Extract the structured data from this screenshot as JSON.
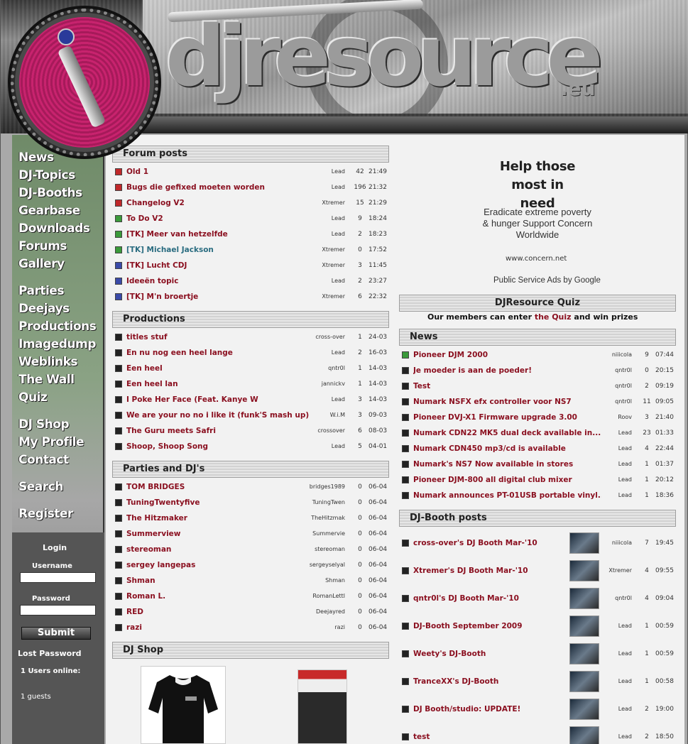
{
  "site": {
    "logo_text": "djresource",
    "logo_tld": ".eu"
  },
  "nav": [
    "News",
    "DJ-Topics",
    "DJ-Booths",
    "Gearbase",
    "Downloads",
    "Forums",
    "Gallery",
    "Parties",
    "Deejays",
    "Productions",
    "Imagedump",
    "Weblinks",
    "The Wall",
    "Quiz",
    "DJ Shop",
    "My Profile",
    "Contact",
    "Search",
    "Register"
  ],
  "login": {
    "title": "Login",
    "username_label": "Username",
    "password_label": "Password",
    "submit": "Submit",
    "lost_password": "Lost Password",
    "users_online": "1 Users online:",
    "guests": "1 guests"
  },
  "forum": {
    "title": "Forum posts",
    "rows": [
      {
        "color": "red",
        "title": "Old 1",
        "user": "Lead",
        "count": "42",
        "time": "21:49"
      },
      {
        "color": "red",
        "title": "Bugs die gefixed moeten worden",
        "user": "Lead",
        "count": "196",
        "time": "21:32"
      },
      {
        "color": "red",
        "title": "Changelog V2",
        "user": "Xtremer",
        "count": "15",
        "time": "21:29"
      },
      {
        "color": "green",
        "title": "To Do V2",
        "user": "Lead",
        "count": "9",
        "time": "18:24"
      },
      {
        "color": "green",
        "title": "[TK] Meer van hetzelfde",
        "user": "Lead",
        "count": "2",
        "time": "18:23"
      },
      {
        "color": "green",
        "title": "[TK] Michael Jackson",
        "user": "Xtremer",
        "count": "0",
        "time": "17:52",
        "teal": true
      },
      {
        "color": "blue",
        "title": "[TK] Lucht CDJ",
        "user": "Xtremer",
        "count": "3",
        "time": "11:45"
      },
      {
        "color": "blue",
        "title": "Ideeën topic",
        "user": "Lead",
        "count": "2",
        "time": "23:27"
      },
      {
        "color": "blue",
        "title": "[TK] M'n broertje",
        "user": "Xtremer",
        "count": "6",
        "time": "22:32"
      }
    ]
  },
  "productions": {
    "title": "Productions",
    "rows": [
      {
        "title": "titles stuf",
        "user": "cross-over",
        "count": "1",
        "time": "24-03"
      },
      {
        "title": "En nu nog een heel lange",
        "user": "Lead",
        "count": "2",
        "time": "16-03"
      },
      {
        "title": "Een heel",
        "user": "qntr0l",
        "count": "1",
        "time": "14-03"
      },
      {
        "title": "Een heel lan",
        "user": "jannickv",
        "count": "1",
        "time": "14-03"
      },
      {
        "title": "I Poke Her Face (Feat. Kanye W",
        "user": "Lead",
        "count": "3",
        "time": "14-03"
      },
      {
        "title": "We are your no no i like it (funk'S mash up)",
        "user": "W.i.M",
        "count": "3",
        "time": "09-03"
      },
      {
        "title": "The Guru meets Safri",
        "user": "crossover",
        "count": "6",
        "time": "08-03"
      },
      {
        "title": "Shoop, Shoop Song",
        "user": "Lead",
        "count": "5",
        "time": "04-01"
      }
    ]
  },
  "parties": {
    "title": "Parties and DJ's",
    "rows": [
      {
        "title": "TOM BRIDGES",
        "user": "bridges1989",
        "count": "0",
        "time": "06-04"
      },
      {
        "title": "TuningTwentyfive",
        "user": "TuningTwen",
        "count": "0",
        "time": "06-04"
      },
      {
        "title": "The Hitzmaker",
        "user": "TheHitzmak",
        "count": "0",
        "time": "06-04"
      },
      {
        "title": "Summerview",
        "user": "Summervie",
        "count": "0",
        "time": "06-04"
      },
      {
        "title": "stereoman",
        "user": "stereoman",
        "count": "0",
        "time": "06-04"
      },
      {
        "title": "sergey langepas",
        "user": "sergeyselyal",
        "count": "0",
        "time": "06-04"
      },
      {
        "title": "Shman",
        "user": "Shman",
        "count": "0",
        "time": "06-04"
      },
      {
        "title": "Roman L.",
        "user": "RomanLettl",
        "count": "0",
        "time": "06-04"
      },
      {
        "title": "RED",
        "user": "Deejayred",
        "count": "0",
        "time": "06-04"
      },
      {
        "title": "razi",
        "user": "razi",
        "count": "0",
        "time": "06-04"
      }
    ]
  },
  "shop": {
    "title": "DJ Shop"
  },
  "ad": {
    "title_line1": "Help those most in",
    "title_line2": "need",
    "body_line1": "Eradicate extreme poverty",
    "body_line2": "& hunger Support Concern",
    "body_line3": "Worldwide",
    "url": "www.concern.net",
    "credit": "Public Service Ads by Google"
  },
  "quiz": {
    "title": "DJResource Quiz",
    "text_before": "Our members can enter ",
    "link": "the Quiz",
    "text_after": " and win prizes"
  },
  "news": {
    "title": "News",
    "rows": [
      {
        "color": "green",
        "title": "Pioneer DJM 2000",
        "user": "niiicola",
        "count": "9",
        "time": "07:44"
      },
      {
        "color": "black",
        "title": "Je moeder is aan de poeder!",
        "user": "qntr0l",
        "count": "0",
        "time": "20:15"
      },
      {
        "color": "black",
        "title": "Test",
        "user": "qntr0l",
        "count": "2",
        "time": "09:19"
      },
      {
        "color": "black",
        "title": "Numark NSFX efx controller voor NS7",
        "user": "qntr0l",
        "count": "11",
        "time": "09:05"
      },
      {
        "color": "black",
        "title": "Pioneer DVJ-X1 Firmware upgrade 3.00",
        "user": "Roov",
        "count": "3",
        "time": "21:40"
      },
      {
        "color": "black",
        "title": "Numark CDN22 MK5 dual deck available in...",
        "user": "Lead",
        "count": "23",
        "time": "01:33"
      },
      {
        "color": "black",
        "title": "Numark CDN450 mp3/cd is available",
        "user": "Lead",
        "count": "4",
        "time": "22:44"
      },
      {
        "color": "black",
        "title": "Numark's NS7 Now available in stores",
        "user": "Lead",
        "count": "1",
        "time": "01:37"
      },
      {
        "color": "black",
        "title": "Pioneer DJM-800 all digital club mixer",
        "user": "Lead",
        "count": "1",
        "time": "20:12"
      },
      {
        "color": "black",
        "title": "Numark announces PT-01USB portable vinyl...",
        "user": "Lead",
        "count": "1",
        "time": "18:36"
      }
    ]
  },
  "booths": {
    "title": "DJ-Booth posts",
    "rows": [
      {
        "title": "cross-over's DJ Booth Mar-'10",
        "user": "niiicola",
        "count": "7",
        "time": "19:45"
      },
      {
        "title": "Xtremer's DJ Booth Mar-'10",
        "user": "Xtremer",
        "count": "4",
        "time": "09:55"
      },
      {
        "title": "qntr0l's DJ Booth Mar-'10",
        "user": "qntr0l",
        "count": "4",
        "time": "09:04"
      },
      {
        "title": "DJ-Booth September 2009",
        "user": "Lead",
        "count": "1",
        "time": "00:59"
      },
      {
        "title": "Weety's DJ-Booth",
        "user": "Lead",
        "count": "1",
        "time": "00:59"
      },
      {
        "title": "TranceXX's DJ-Booth",
        "user": "Lead",
        "count": "1",
        "time": "00:58"
      },
      {
        "title": "DJ Booth/studio: UPDATE!",
        "user": "Lead",
        "count": "2",
        "time": "19:00"
      },
      {
        "title": "test",
        "user": "Lead",
        "count": "2",
        "time": "18:50"
      }
    ]
  }
}
